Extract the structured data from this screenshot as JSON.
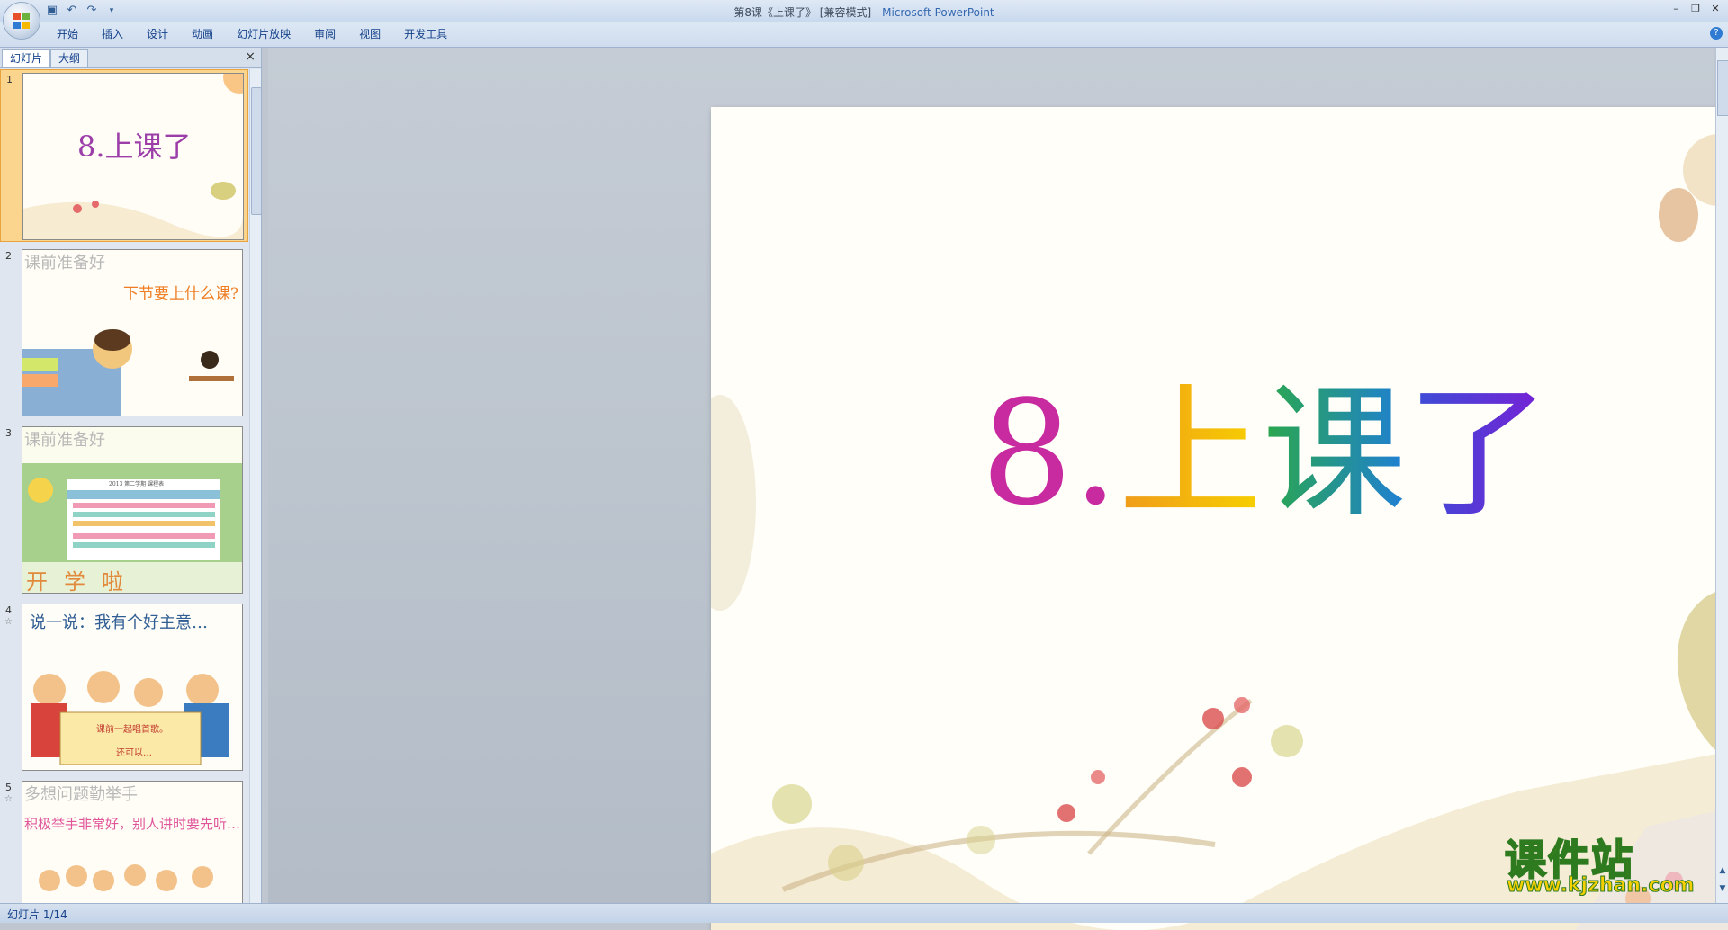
{
  "window": {
    "doc_title": "第8课《上课了》 [兼容模式]",
    "separator": " - ",
    "app_name": "Microsoft PowerPoint"
  },
  "qat": {
    "save_icon": "save-icon",
    "undo_icon": "undo-icon",
    "redo_icon": "redo-icon"
  },
  "menu": [
    "开始",
    "插入",
    "设计",
    "动画",
    "幻灯片放映",
    "审阅",
    "视图",
    "开发工具"
  ],
  "panel": {
    "tabs": [
      "幻灯片",
      "大纲"
    ],
    "close_label": "×"
  },
  "thumbnails": [
    {
      "num": "1",
      "title": "8.上课了"
    },
    {
      "num": "2",
      "title": "课前准备好",
      "subtitle": "下节要上什么课?"
    },
    {
      "num": "3",
      "title": "课前准备好",
      "subtitle": "2013 第二学期 课程表",
      "footer": "开学啦"
    },
    {
      "num": "4",
      "title": "说一说：我有个好主意…",
      "line1": "课前一起唱首歌。",
      "line2": "还可以…"
    },
    {
      "num": "5",
      "title": "多想问题勤举手",
      "subtitle": "积极举手非常好，别人讲时要先听…"
    }
  ],
  "slide": {
    "title_number": "8.",
    "title_chars": [
      "上",
      "课",
      "了"
    ]
  },
  "status": {
    "slide_counter": "幻灯片 1/14"
  },
  "watermark": {
    "text_cn": "课件站",
    "url": "www.kjzhan.com"
  }
}
